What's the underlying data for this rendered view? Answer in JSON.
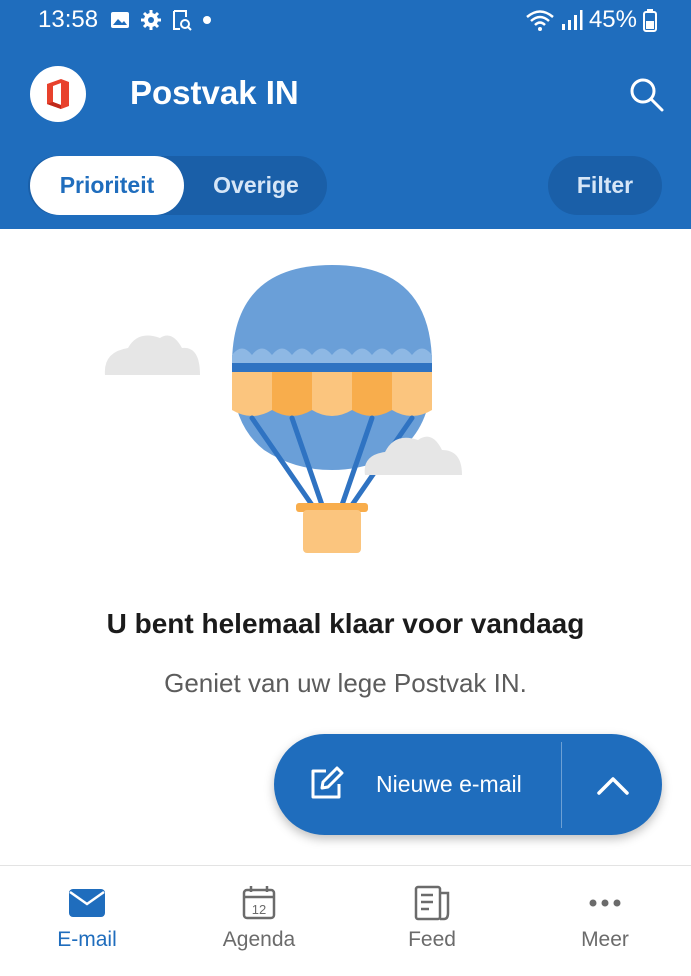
{
  "status_bar": {
    "time": "13:58",
    "battery": "45%",
    "left_icons": [
      "image-icon",
      "gear-icon",
      "screenshot-icon",
      "dot-icon"
    ],
    "right_icons": [
      "wifi-icon",
      "signal-icon",
      "battery-icon"
    ]
  },
  "header": {
    "title": "Postvak IN",
    "logo": "office-logo",
    "search_icon": "search-icon"
  },
  "tabs": {
    "items": [
      {
        "label": "Prioriteit",
        "selected": true
      },
      {
        "label": "Overige",
        "selected": false
      }
    ],
    "filter_label": "Filter"
  },
  "empty_state": {
    "illustration": "hot-air-balloon",
    "title": "U bent helemaal klaar voor vandaag",
    "subtitle": "Geniet van uw lege Postvak IN."
  },
  "fab": {
    "label": "Nieuwe e-mail",
    "compose_icon": "compose-icon",
    "expand_icon": "chevron-up-icon"
  },
  "bottom_nav": {
    "items": [
      {
        "label": "E-mail",
        "icon": "mail-icon",
        "active": true
      },
      {
        "label": "Agenda",
        "icon": "calendar-icon",
        "active": false,
        "badge": "12"
      },
      {
        "label": "Feed",
        "icon": "feed-icon",
        "active": false
      },
      {
        "label": "Meer",
        "icon": "more-icon",
        "active": false
      }
    ]
  },
  "colors": {
    "brand_blue": "#1f6dbd",
    "tab_pill": "#1a5fa8",
    "balloon_blue": "#6a9fd8",
    "balloon_orange": "#fbc57e",
    "cloud": "#e6e6e6"
  }
}
